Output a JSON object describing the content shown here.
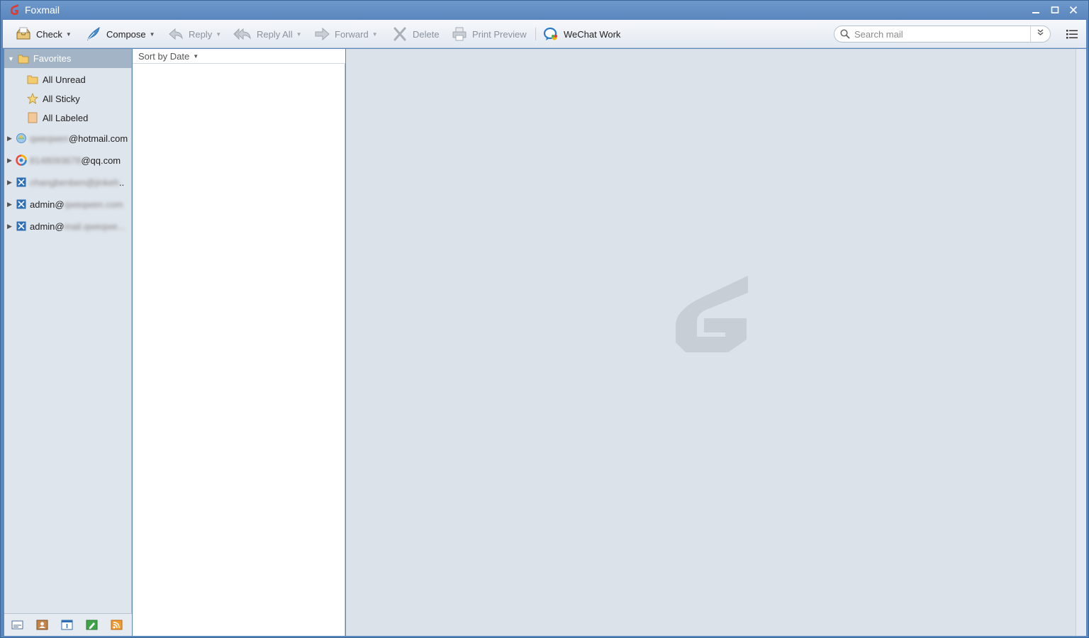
{
  "window": {
    "title": "Foxmail"
  },
  "toolbar": {
    "check_label": "Check",
    "compose_label": "Compose",
    "reply_label": "Reply",
    "reply_all_label": "Reply All",
    "forward_label": "Forward",
    "delete_label": "Delete",
    "print_preview_label": "Print Preview",
    "wechat_work_label": "WeChat Work"
  },
  "search": {
    "placeholder": "Search mail"
  },
  "sidebar": {
    "favorites_label": "Favorites",
    "favorites": [
      {
        "label": "All Unread",
        "icon": "folder-icon"
      },
      {
        "label": "All Sticky",
        "icon": "star-icon"
      },
      {
        "label": "All Labeled",
        "icon": "label-icon"
      }
    ],
    "accounts": [
      {
        "hidden": "qweqwen",
        "visible": "@hotmail.com",
        "icon": "hotmail-account-icon"
      },
      {
        "hidden": "8148093678",
        "visible": "@qq.com",
        "icon": "qq-account-icon"
      },
      {
        "hidden": "changbenben@jinkeh",
        "visible": "..",
        "icon": "exchange-account-icon"
      },
      {
        "visible": "admin@",
        "hidden": "qweqwen.com",
        "icon": "exchange-account-icon"
      },
      {
        "visible": "admin@",
        "hidden": "mail.qweqwe...",
        "icon": "exchange-account-icon"
      }
    ]
  },
  "mail_list": {
    "sort_label": "Sort by Date"
  },
  "colors": {
    "titlebar": "#5b87bf",
    "favorites_header": "#a3b4c6",
    "reading_pane": "#dce2e9",
    "watermark": "#c8ced6"
  }
}
